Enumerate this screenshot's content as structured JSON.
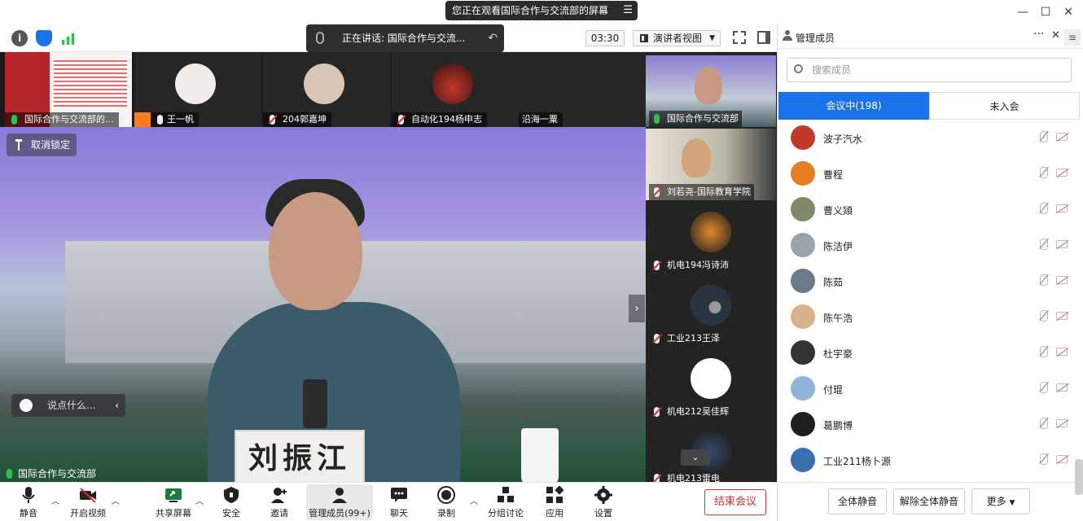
{
  "banner": {
    "text": "您正在观看国际合作与交流部的屏幕"
  },
  "window": {
    "minimize": "—",
    "maximize": "☐",
    "close": "✕"
  },
  "toolbar": {
    "speaking": "正在讲话: 国际合作与交流...",
    "timer": "03:30",
    "view": "演讲者视图"
  },
  "strip": [
    {
      "name": "国际合作与交流部的..."
    },
    {
      "name": "王一帆"
    },
    {
      "name": "204郭嘉坤"
    },
    {
      "name": "自动化194杨申志"
    },
    {
      "name": "沿海一粟"
    }
  ],
  "main": {
    "pin_label": "取消锁定",
    "chat_placeholder": "说点什么...",
    "presenter_label": "国际合作与交流部",
    "nameplate": "刘振江"
  },
  "side": [
    {
      "name": "国际合作与交流部"
    },
    {
      "name": "刘若尧-国际教育学院"
    },
    {
      "name": "机电194冯诗沛"
    },
    {
      "name": "工业213王泽"
    },
    {
      "name": "机电212吴佳辉"
    },
    {
      "name": "机电213雷电"
    }
  ],
  "bottom": {
    "mute": "静音",
    "video": "开启视频",
    "share": "共享屏幕",
    "security": "安全",
    "invite": "邀请",
    "members": "管理成员(99+)",
    "chat": "聊天",
    "record": "录制",
    "breakout": "分组讨论",
    "apps": "应用",
    "settings": "设置",
    "end": "结束会议"
  },
  "panel": {
    "title": "管理成员",
    "search_placeholder": "搜索成员",
    "tab_in": "会议中(198)",
    "tab_out": "未入会",
    "members": [
      {
        "name": "波子汽水",
        "color": "#c0392b"
      },
      {
        "name": "曹程",
        "color": "#e67e22"
      },
      {
        "name": "曹义熲",
        "color": "#7d8b6a"
      },
      {
        "name": "陈洁伊",
        "color": "#9aa3a8"
      },
      {
        "name": "陈茹",
        "color": "#6b7b8c"
      },
      {
        "name": "陈午浩",
        "color": "#d8b08a"
      },
      {
        "name": "杜宇豪",
        "color": "#333333"
      },
      {
        "name": "付琨",
        "color": "#8fb4d9"
      },
      {
        "name": "葛鹏博",
        "color": "#1f1f1f"
      },
      {
        "name": "工业211杨卜源",
        "color": "#3a6fb0"
      }
    ],
    "mute_all": "全体静音",
    "unmute_all": "解除全体静音",
    "more": "更多"
  }
}
